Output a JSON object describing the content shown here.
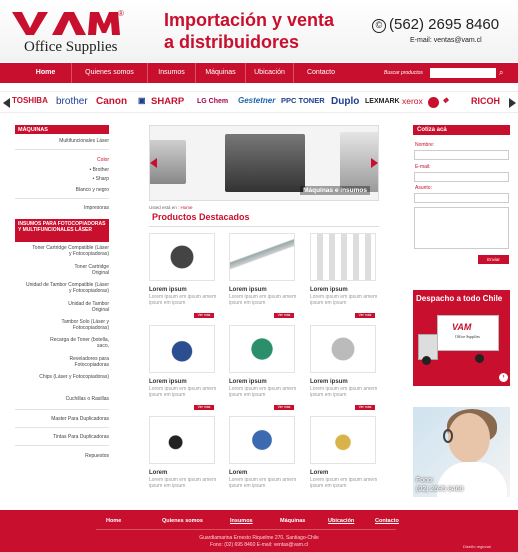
{
  "header": {
    "logo_text": "VAM",
    "logo_reg": "®",
    "logo_sub": "Office Supplies",
    "tagline_1": "Importación y venta",
    "tagline_2": "a distribuidores",
    "phone_icon": "©",
    "phone": "(562) 2695 8460",
    "email": "E-mail: ventas@vam.cl"
  },
  "nav": {
    "items": [
      "Home",
      "Quienes somos",
      "Insumos",
      "Máquinas",
      "Ubicación",
      "Contacto"
    ],
    "search_label": "Buscar productos"
  },
  "brands": [
    "TOSHIBA",
    "brother",
    "Canon",
    "SHARP",
    "LG Chem",
    "Gestetner",
    "PPC TONER",
    "Duplo",
    "LEXMARK",
    "xerox",
    "RICOH"
  ],
  "sidebar": {
    "machines_title": "MÁQUINAS",
    "machines": [
      "Multifuncionales Láser",
      "Color",
      "• Brother",
      "• Sharp",
      "Blanco y negro",
      "Impresoras"
    ],
    "supplies_title": "INSUMOS PARA FOTOCOPIADORAS Y MULTIFUNCIONALES LÁSER",
    "supplies": [
      "Toner Cartridge Compatible (Láser y Fotocopiadoras)",
      "Toner Cartridge Original",
      "Unidad de Tambor Compatible (Láser y Fotocopiadoras)",
      "Unidad de Tambor Original",
      "Tambor Solo (Láser y Fotocopiadoras)",
      "Recarga de Toner (botella, saco,",
      "Reveladores para Fotocopiadoras",
      "Chips (Láser y Fotocopiadoras)",
      "Cuchillas o Rasillas",
      "Master Para Duplicadoras",
      "Tintas Para Duplicadoras",
      "Repuestos"
    ]
  },
  "slider": {
    "caption": "Máquinas e insumos"
  },
  "breadcrumb": {
    "prefix": "Usted está en :",
    "current": "Home"
  },
  "products_title": "Productos Destacados",
  "products": [
    {
      "name": "Lorem ipsum",
      "desc": "Lorem ipsum em ipsum amem ipsum em ipsum",
      "btn": "Ver más"
    },
    {
      "name": "Lorem ipsum",
      "desc": "Lorem ipsum em ipsum amem ipsum em ipsum",
      "btn": "Ver más"
    },
    {
      "name": "Lorem ipsum",
      "desc": "Lorem ipsum em ipsum amem ipsum em ipsum",
      "btn": "Ver más"
    },
    {
      "name": "Lorem ipsum",
      "desc": "Lorem ipsum em ipsum amem ipsum em ipsum",
      "btn": "Ver más"
    },
    {
      "name": "Lorem ipsum",
      "desc": "Lorem ipsum em ipsum amem ipsum em ipsum",
      "btn": "Ver más"
    },
    {
      "name": "Lorem ipsum",
      "desc": "Lorem ipsum em ipsum amem ipsum em ipsum",
      "btn": "Ver más"
    },
    {
      "name": "Lorem",
      "desc": "Lorem ipsum em ipsum amem ipsum em ipsum",
      "btn": "Ver más"
    },
    {
      "name": "Lorem",
      "desc": "Lorem ipsum em ipsum amem ipsum em ipsum",
      "btn": "Ver más"
    },
    {
      "name": "Lorem",
      "desc": "Lorem ipsum em ipsum amem ipsum em ipsum",
      "btn": "Ver más"
    }
  ],
  "form": {
    "title": "Cotiza acá",
    "name_label": "Nombre:",
    "email_label": "E-mail:",
    "subject_label": "Asunto:",
    "submit": "Enviar"
  },
  "promo": {
    "title": "Despacho a todo Chile",
    "truck_logo": "VAM",
    "truck_sub": "Office Supplies",
    "arrow": "›"
  },
  "agent": {
    "line1": "Fono:",
    "line2": "(02) 2695 8460"
  },
  "footer": {
    "nav": [
      "Home",
      "Quienes somos",
      "Insumos",
      "Máquinas",
      "Ubicación",
      "Contacto"
    ],
    "address": "Guardiamarina Ernesto Riquelme 270, Santiago-Chile",
    "contact": "Fono: (02) 695 8460 E-mail: ventas@vam.cl",
    "credit": "Diseño regional"
  },
  "colors": {
    "accent": "#c8102e",
    "text": "#333333",
    "muted": "#9a9a9a"
  }
}
